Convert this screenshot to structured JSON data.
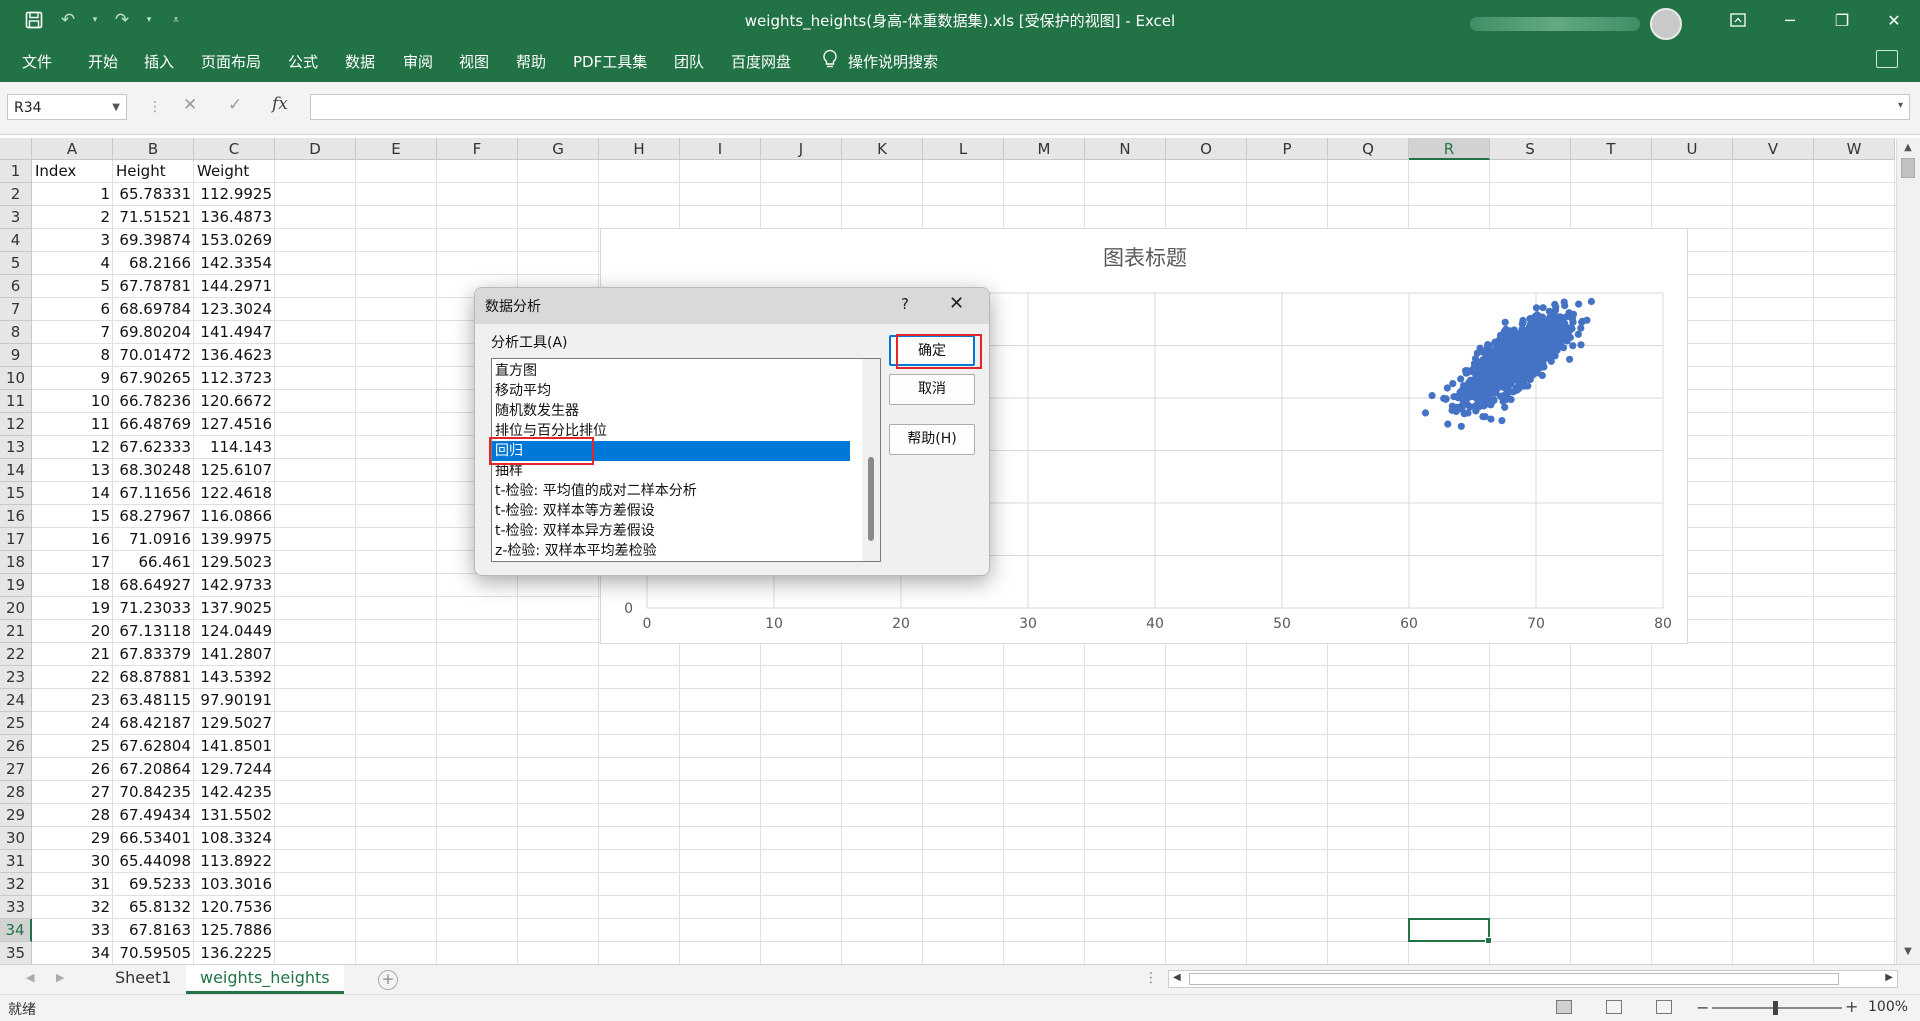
{
  "window": {
    "title": "weights_heights(身高-体重数据集).xls  [受保护的视图]  -  Excel"
  },
  "ribbon": {
    "tabs": [
      "文件",
      "开始",
      "插入",
      "页面布局",
      "公式",
      "数据",
      "审阅",
      "视图",
      "帮助",
      "PDF工具集",
      "团队",
      "百度网盘"
    ],
    "tell_me": "操作说明搜索"
  },
  "formula_bar": {
    "name_box": "R34",
    "fx": "fx",
    "content": ""
  },
  "sheet": {
    "columns": [
      "A",
      "B",
      "C",
      "D",
      "E",
      "F",
      "G",
      "H",
      "I",
      "J",
      "K",
      "L",
      "M",
      "N",
      "O",
      "P",
      "Q",
      "R",
      "S",
      "T",
      "U",
      "V",
      "W"
    ],
    "selected_column": "R",
    "selected_row": "34",
    "row_numbers": [
      "1",
      "2",
      "3",
      "4",
      "5",
      "6",
      "7",
      "8",
      "9",
      "10",
      "11",
      "12",
      "13",
      "14",
      "15",
      "16",
      "17",
      "18",
      "19",
      "20",
      "21",
      "22",
      "23",
      "24",
      "25",
      "26",
      "27",
      "28",
      "29",
      "30",
      "31",
      "32",
      "33",
      "34",
      "35"
    ],
    "headers": [
      "Index",
      "Height",
      "Weight"
    ],
    "rows": [
      [
        "1",
        "65.78331",
        "112.9925"
      ],
      [
        "2",
        "71.51521",
        "136.4873"
      ],
      [
        "3",
        "69.39874",
        "153.0269"
      ],
      [
        "4",
        "68.2166",
        "142.3354"
      ],
      [
        "5",
        "67.78781",
        "144.2971"
      ],
      [
        "6",
        "68.69784",
        "123.3024"
      ],
      [
        "7",
        "69.80204",
        "141.4947"
      ],
      [
        "8",
        "70.01472",
        "136.4623"
      ],
      [
        "9",
        "67.90265",
        "112.3723"
      ],
      [
        "10",
        "66.78236",
        "120.6672"
      ],
      [
        "11",
        "66.48769",
        "127.4516"
      ],
      [
        "12",
        "67.62333",
        "114.143"
      ],
      [
        "13",
        "68.30248",
        "125.6107"
      ],
      [
        "14",
        "67.11656",
        "122.4618"
      ],
      [
        "15",
        "68.27967",
        "116.0866"
      ],
      [
        "16",
        "71.0916",
        "139.9975"
      ],
      [
        "17",
        "66.461",
        "129.5023"
      ],
      [
        "18",
        "68.64927",
        "142.9733"
      ],
      [
        "19",
        "71.23033",
        "137.9025"
      ],
      [
        "20",
        "67.13118",
        "124.0449"
      ],
      [
        "21",
        "67.83379",
        "141.2807"
      ],
      [
        "22",
        "68.87881",
        "143.5392"
      ],
      [
        "23",
        "63.48115",
        "97.90191"
      ],
      [
        "24",
        "68.42187",
        "129.5027"
      ],
      [
        "25",
        "67.62804",
        "141.8501"
      ],
      [
        "26",
        "67.20864",
        "129.7244"
      ],
      [
        "27",
        "70.84235",
        "142.4235"
      ],
      [
        "28",
        "67.49434",
        "131.5502"
      ],
      [
        "29",
        "66.53401",
        "108.3324"
      ],
      [
        "30",
        "65.44098",
        "113.8922"
      ],
      [
        "31",
        "69.5233",
        "103.3016"
      ],
      [
        "32",
        "65.8132",
        "120.7536"
      ],
      [
        "33",
        "67.8163",
        "125.7886"
      ],
      [
        "34",
        "70.59505",
        "136.2225"
      ]
    ]
  },
  "chart_data": {
    "type": "scatter",
    "title": "图表标题",
    "xlabel": "",
    "ylabel": "",
    "xlim": [
      0,
      80
    ],
    "x_ticks": [
      "0",
      "10",
      "20",
      "30",
      "40",
      "50",
      "60",
      "70",
      "80"
    ],
    "y_ticks_visible": [
      "0"
    ],
    "grid": true,
    "color": "#4472c4",
    "cluster": {
      "x_center": 68.4,
      "x_range": [
        60.5,
        75.5
      ],
      "note_values": "dense cloud of ~ thousands of points"
    }
  },
  "dialog": {
    "title": "数据分析",
    "help_glyph": "?",
    "close_glyph": "✕",
    "label": "分析工具(A)",
    "items": [
      "直方图",
      "移动平均",
      "随机数发生器",
      "排位与百分比排位",
      "回归",
      "抽样",
      "t-检验: 平均值的成对二样本分析",
      "t-检验: 双样本等方差假设",
      "t-检验: 双样本异方差假设",
      "z-检验: 双样本平均差检验"
    ],
    "selected_index": 4,
    "buttons": {
      "ok": "确定",
      "cancel": "取消",
      "help": "帮助(H)"
    }
  },
  "sheet_tabs": [
    "Sheet1",
    "weights_heights"
  ],
  "active_sheet": "weights_heights",
  "status": {
    "text": "就绪",
    "zoom": "100%"
  }
}
